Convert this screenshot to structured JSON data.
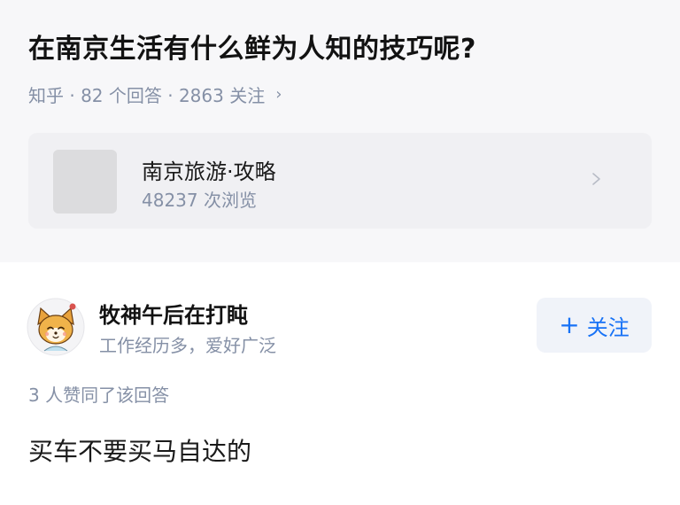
{
  "question": {
    "title": "在南京生活有什么鲜为人知的技巧呢?",
    "meta": "知乎 · 82 个回答 · 2863 关注",
    "meta_chevron": "›"
  },
  "topic_card": {
    "name": "南京旅游·攻略",
    "views": "48237 次浏览",
    "chevron_icon": "chevron-right-icon"
  },
  "answer": {
    "author": {
      "name": "牧神午后在打盹",
      "bio": "工作经历多，爱好广泛",
      "avatar_icon": "cartoon-dog-avatar"
    },
    "follow_button": {
      "plus": "+",
      "label": "关注"
    },
    "upvote_note": "3 人赞同了该回答",
    "content": "买车不要买马自达的"
  },
  "colors": {
    "accent": "#1772f6",
    "muted": "#8590a6",
    "section_bg": "#f7f7f9",
    "card_bg": "#f0f0f3"
  }
}
